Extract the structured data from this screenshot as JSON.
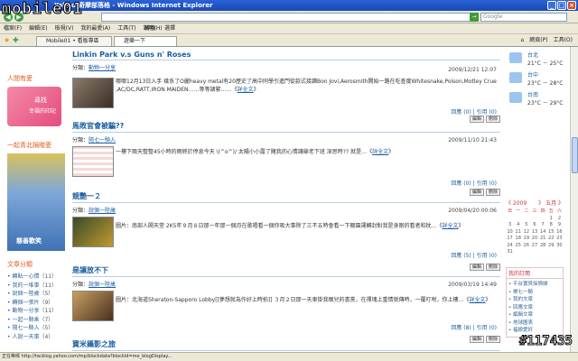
{
  "watermark": "mobile01",
  "watermark_id": "#117435",
  "window": {
    "title": "Yahoo!奇摩部落格 - Windows Internet Explorer",
    "min": "_",
    "max": "□",
    "close": "×"
  },
  "address": {
    "url": "",
    "search_placeholder": "Google"
  },
  "menu": [
    "檔案(F)",
    "編輯(E)",
    "檢視(V)",
    "我的最愛(A)",
    "工具(T)",
    "說明(H)"
  ],
  "toolbar": {
    "translate": "轉換",
    "select": "選擇"
  },
  "tabs": [
    {
      "label": "Mobile01 • 看板專區"
    },
    {
      "label": "遊樂一下"
    }
  ],
  "tab_tools": {
    "page": "網頁(P)",
    "tools": "工具(O)"
  },
  "left": {
    "promo_title": "人間有愛",
    "promo_line1": "尋找",
    "promo_line2": "幸福的印記",
    "sub_title": "一起青北捐贈愛",
    "photo_caption": "慈善歡笑",
    "cat_title": "文章分類",
    "categories": [
      {
        "name": "轉貼一心情",
        "count": "（11）"
      },
      {
        "name": "我的一堆事",
        "count": "（11）"
      },
      {
        "name": "說個一陸歲",
        "count": "（5）"
      },
      {
        "name": "轉個一張片",
        "count": "（9）"
      },
      {
        "name": "動物一分享",
        "count": "（11）"
      },
      {
        "name": "一起一騎乘",
        "count": "（7）"
      },
      {
        "name": "隨七一騎入",
        "count": "（5）"
      },
      {
        "name": "人說一天事",
        "count": "（4）"
      }
    ]
  },
  "posts": [
    {
      "title": "Linkin Park v.s Guns n' Roses",
      "cat_label": "分類：",
      "cat": "動物一分享",
      "date": "2009/12/21 12:07",
      "text": "哪哪12月13日入手  幾系了O麗heavy metal有20歷史了高中同學引進門從款式接讀Bon Jovi,Aerosmith開始一路在吃查度Whitesnake,Poison,Motley Crue ,AC/DC,RATT,IRON MAIDEN……等等諸繁……《",
      "more": "詳全文",
      "more_end": "》",
      "foot": "回應 (0) | 引用 (0)"
    },
    {
      "title": "馬敗官會被騙??",
      "cat_label": "分類：",
      "cat": "隨七一騎入",
      "date": "2009/11/10 21:43",
      "text": "一樓下兩天整整45小時的雨終於停息今天  \\(^o^)/ 太陽小小露了賭我的心情讓爺老下班 深思時??                就是…《",
      "more": "詳全文",
      "more_end": "》",
      "foot": "回應 (0) | 引用 (0)"
    },
    {
      "title": "競艷一２",
      "cat_label": "分類：",
      "cat": "說個一陸歲",
      "date": "2009/04/20 00:06",
      "text": "圖片：南部人鬧天堂                2K5年９月８日那一年那一個月在歌唱看一個你吸大事除了三不五時會看一下棚園運轉封對我是身剛的看者和枕…《",
      "more": "詳全文",
      "more_end": "》",
      "foot": "回應 (5) | 引用 (0)"
    },
    {
      "title": "是讓放不下",
      "cat_label": "分類：",
      "cat": "說個一陸歲",
      "date": "2009/03/19 14:49",
      "text": "圖片：北海道Sheraton-Sapporo Lobby[[夢想就為作好上時拍]]          ３月２日那一天車掛我眼兒的書黨，在禪塊上重情就傳時，一覆叮咐，你上樓…《",
      "more": "詳全文",
      "more_end": "》",
      "foot": "回應 (8) | 引用 (0)"
    },
    {
      "title": "寶米攝影之旅",
      "cat_label": "",
      "cat": "",
      "date": "",
      "text": "",
      "more": "",
      "more_end": "",
      "foot": ""
    }
  ],
  "post_buttons": {
    "edit": "編輯",
    "delete": "刪除"
  },
  "right": {
    "weather": [
      {
        "city": "台北",
        "temp": "21°C － 25°C"
      },
      {
        "city": "台中",
        "temp": "23°C － 28°C"
      },
      {
        "city": "台南",
        "temp": "23°C － 29°C"
      }
    ],
    "calendar": {
      "prev": "《 2009",
      "next": "》 五月 》",
      "headers": [
        "日",
        "一",
        "二",
        "三",
        "四",
        "五",
        "六"
      ],
      "days": [
        "",
        "",
        "",
        "",
        "",
        "1",
        "2",
        "3",
        "4",
        "5",
        "6",
        "7",
        "8",
        "9",
        "10",
        "11",
        "12",
        "13",
        "14",
        "15",
        "16",
        "17",
        "18",
        "19",
        "20",
        "21",
        "22",
        "23",
        "24",
        "25",
        "26",
        "27",
        "28",
        "29",
        "30",
        "31",
        "",
        "",
        "",
        "",
        "",
        ""
      ]
    },
    "sub_title": "我的訂閱",
    "subscriptions": [
      "平台寶貝採情婦",
      "樂七一騎",
      "我的文章",
      "回應文章",
      "編輯文章",
      "地球圖表",
      "福娘愛好"
    ]
  },
  "status": {
    "text": "正在等候 http://tw.blog.yahoo.com/mp/blockdata?blockId=me_blogDisplay..."
  }
}
